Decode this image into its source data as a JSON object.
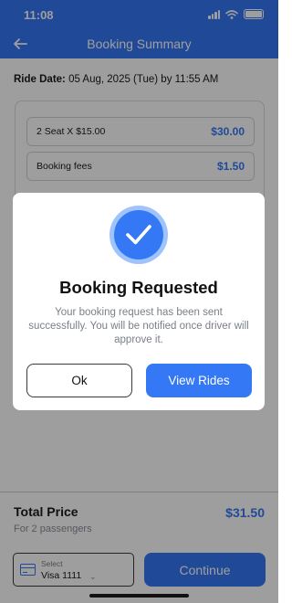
{
  "status_bar": {
    "time": "11:08"
  },
  "nav": {
    "title": "Booking Summary",
    "back_icon": "back-arrow-icon"
  },
  "ride": {
    "label": "Ride Date:",
    "value": " 05 Aug, 2025 (Tue) by 11:55 AM"
  },
  "price_rows": [
    {
      "label": "2 Seat X $15.00",
      "amount": "$30.00"
    },
    {
      "label": "Booking fees",
      "amount": "$1.50"
    }
  ],
  "dialog": {
    "icon": "checkmark-icon",
    "title": "Booking Requested",
    "message": "Your booking request has been sent successfully. You will be notified once driver will approve it.",
    "ok_label": "Ok",
    "view_label": "View Rides"
  },
  "total": {
    "label": "Total Price",
    "sub": "For 2 passengers",
    "amount": "$31.50"
  },
  "payment": {
    "label": "Select",
    "value": "Visa 1111"
  },
  "continue_label": "Continue",
  "colors": {
    "accent": "#3478f6",
    "accent_light": "#9fc3fb",
    "overlay": "rgba(0,0,0,0.38)"
  }
}
